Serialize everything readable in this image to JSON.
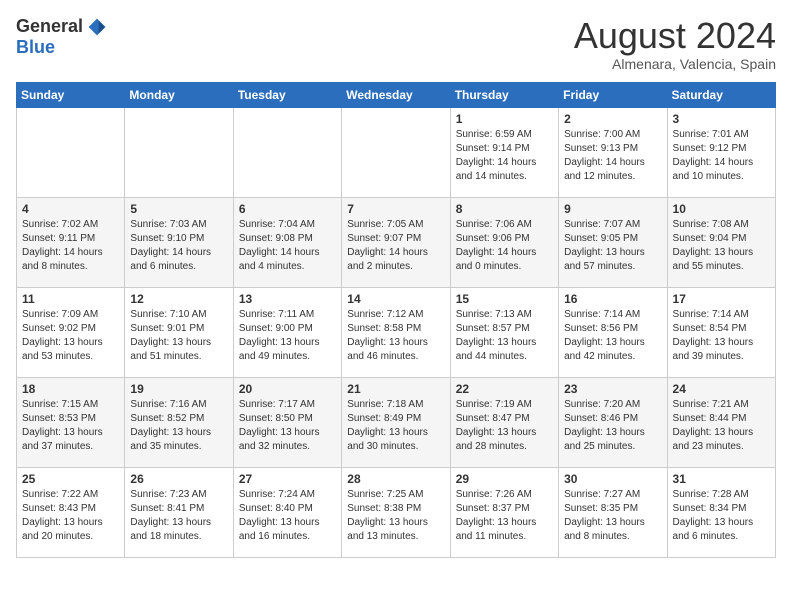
{
  "logo": {
    "general": "General",
    "blue": "Blue"
  },
  "title": "August 2024",
  "location": "Almenara, Valencia, Spain",
  "days_of_week": [
    "Sunday",
    "Monday",
    "Tuesday",
    "Wednesday",
    "Thursday",
    "Friday",
    "Saturday"
  ],
  "weeks": [
    [
      {
        "day": "",
        "info": ""
      },
      {
        "day": "",
        "info": ""
      },
      {
        "day": "",
        "info": ""
      },
      {
        "day": "",
        "info": ""
      },
      {
        "day": "1",
        "info": "Sunrise: 6:59 AM\nSunset: 9:14 PM\nDaylight: 14 hours\nand 14 minutes."
      },
      {
        "day": "2",
        "info": "Sunrise: 7:00 AM\nSunset: 9:13 PM\nDaylight: 14 hours\nand 12 minutes."
      },
      {
        "day": "3",
        "info": "Sunrise: 7:01 AM\nSunset: 9:12 PM\nDaylight: 14 hours\nand 10 minutes."
      }
    ],
    [
      {
        "day": "4",
        "info": "Sunrise: 7:02 AM\nSunset: 9:11 PM\nDaylight: 14 hours\nand 8 minutes."
      },
      {
        "day": "5",
        "info": "Sunrise: 7:03 AM\nSunset: 9:10 PM\nDaylight: 14 hours\nand 6 minutes."
      },
      {
        "day": "6",
        "info": "Sunrise: 7:04 AM\nSunset: 9:08 PM\nDaylight: 14 hours\nand 4 minutes."
      },
      {
        "day": "7",
        "info": "Sunrise: 7:05 AM\nSunset: 9:07 PM\nDaylight: 14 hours\nand 2 minutes."
      },
      {
        "day": "8",
        "info": "Sunrise: 7:06 AM\nSunset: 9:06 PM\nDaylight: 14 hours\nand 0 minutes."
      },
      {
        "day": "9",
        "info": "Sunrise: 7:07 AM\nSunset: 9:05 PM\nDaylight: 13 hours\nand 57 minutes."
      },
      {
        "day": "10",
        "info": "Sunrise: 7:08 AM\nSunset: 9:04 PM\nDaylight: 13 hours\nand 55 minutes."
      }
    ],
    [
      {
        "day": "11",
        "info": "Sunrise: 7:09 AM\nSunset: 9:02 PM\nDaylight: 13 hours\nand 53 minutes."
      },
      {
        "day": "12",
        "info": "Sunrise: 7:10 AM\nSunset: 9:01 PM\nDaylight: 13 hours\nand 51 minutes."
      },
      {
        "day": "13",
        "info": "Sunrise: 7:11 AM\nSunset: 9:00 PM\nDaylight: 13 hours\nand 49 minutes."
      },
      {
        "day": "14",
        "info": "Sunrise: 7:12 AM\nSunset: 8:58 PM\nDaylight: 13 hours\nand 46 minutes."
      },
      {
        "day": "15",
        "info": "Sunrise: 7:13 AM\nSunset: 8:57 PM\nDaylight: 13 hours\nand 44 minutes."
      },
      {
        "day": "16",
        "info": "Sunrise: 7:14 AM\nSunset: 8:56 PM\nDaylight: 13 hours\nand 42 minutes."
      },
      {
        "day": "17",
        "info": "Sunrise: 7:14 AM\nSunset: 8:54 PM\nDaylight: 13 hours\nand 39 minutes."
      }
    ],
    [
      {
        "day": "18",
        "info": "Sunrise: 7:15 AM\nSunset: 8:53 PM\nDaylight: 13 hours\nand 37 minutes."
      },
      {
        "day": "19",
        "info": "Sunrise: 7:16 AM\nSunset: 8:52 PM\nDaylight: 13 hours\nand 35 minutes."
      },
      {
        "day": "20",
        "info": "Sunrise: 7:17 AM\nSunset: 8:50 PM\nDaylight: 13 hours\nand 32 minutes."
      },
      {
        "day": "21",
        "info": "Sunrise: 7:18 AM\nSunset: 8:49 PM\nDaylight: 13 hours\nand 30 minutes."
      },
      {
        "day": "22",
        "info": "Sunrise: 7:19 AM\nSunset: 8:47 PM\nDaylight: 13 hours\nand 28 minutes."
      },
      {
        "day": "23",
        "info": "Sunrise: 7:20 AM\nSunset: 8:46 PM\nDaylight: 13 hours\nand 25 minutes."
      },
      {
        "day": "24",
        "info": "Sunrise: 7:21 AM\nSunset: 8:44 PM\nDaylight: 13 hours\nand 23 minutes."
      }
    ],
    [
      {
        "day": "25",
        "info": "Sunrise: 7:22 AM\nSunset: 8:43 PM\nDaylight: 13 hours\nand 20 minutes."
      },
      {
        "day": "26",
        "info": "Sunrise: 7:23 AM\nSunset: 8:41 PM\nDaylight: 13 hours\nand 18 minutes."
      },
      {
        "day": "27",
        "info": "Sunrise: 7:24 AM\nSunset: 8:40 PM\nDaylight: 13 hours\nand 16 minutes."
      },
      {
        "day": "28",
        "info": "Sunrise: 7:25 AM\nSunset: 8:38 PM\nDaylight: 13 hours\nand 13 minutes."
      },
      {
        "day": "29",
        "info": "Sunrise: 7:26 AM\nSunset: 8:37 PM\nDaylight: 13 hours\nand 11 minutes."
      },
      {
        "day": "30",
        "info": "Sunrise: 7:27 AM\nSunset: 8:35 PM\nDaylight: 13 hours\nand 8 minutes."
      },
      {
        "day": "31",
        "info": "Sunrise: 7:28 AM\nSunset: 8:34 PM\nDaylight: 13 hours\nand 6 minutes."
      }
    ]
  ]
}
